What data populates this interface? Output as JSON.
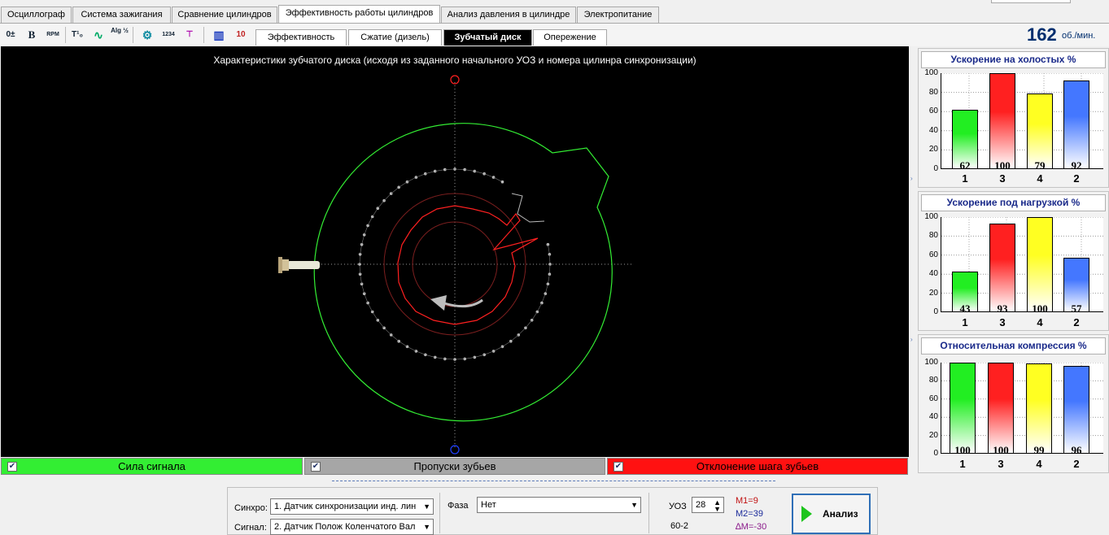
{
  "top_tabs": [
    {
      "label": "Осциллограф"
    },
    {
      "label": "Система зажигания"
    },
    {
      "label": "Сравнение цилиндров"
    },
    {
      "label": "Эффективность работы цилиндров",
      "active": true
    },
    {
      "label": "Анализ давления в цилиндре"
    },
    {
      "label": "Электропитание"
    }
  ],
  "toolbar": {
    "icons": [
      "zero-offset-icon",
      "bold-b-icon",
      "rpm-icon",
      "trigger-icon",
      "waveform-icon",
      "algorithm-icon",
      "tooth-wheel-icon",
      "cylinder-order-icon",
      "filter-icon",
      "bar-chart-icon",
      "scale-icon"
    ],
    "icon_glyphs": [
      "0±",
      "B",
      "RPM",
      "T¹₀",
      "∿",
      "Alg ½",
      "⚙",
      "1234",
      "⊤",
      "▥",
      "10"
    ],
    "sub_tabs": [
      {
        "label": "Эффективность"
      },
      {
        "label": "Сжатие (дизель)"
      },
      {
        "label": "Зубчатый диск",
        "active": true
      },
      {
        "label": "Опережение"
      }
    ]
  },
  "rpm": {
    "value": "162",
    "unit": "об./мин."
  },
  "canvas": {
    "title": "Характеристики зубчатого диска (исходя из заданного начального УОЗ и номера цилинра синхронизации)"
  },
  "legend": [
    {
      "label": "Сила сигнала",
      "checked": true,
      "color": "#33ee33"
    },
    {
      "label": "Пропуски зубьев",
      "checked": true,
      "color": "#a6a6a6"
    },
    {
      "label": "Отклонение шага зубьев",
      "checked": true,
      "color": "#ff1111"
    }
  ],
  "chart_data": [
    {
      "type": "bar",
      "title": "Ускорение на холостых %",
      "categories": [
        "1",
        "3",
        "4",
        "2"
      ],
      "values": [
        62,
        100,
        79,
        92
      ],
      "ylim": [
        0,
        100
      ],
      "yticks": [
        "0",
        "20",
        "40",
        "60",
        "80",
        "100"
      ],
      "colors": [
        "#22ee22",
        "#ff2020",
        "#ffff22",
        "#4477ff"
      ]
    },
    {
      "type": "bar",
      "title": "Ускорение под нагрузкой %",
      "categories": [
        "1",
        "3",
        "4",
        "2"
      ],
      "values": [
        43,
        93,
        100,
        57
      ],
      "ylim": [
        0,
        100
      ],
      "yticks": [
        "0",
        "20",
        "40",
        "60",
        "80",
        "100"
      ],
      "colors": [
        "#22ee22",
        "#ff2020",
        "#ffff22",
        "#4477ff"
      ]
    },
    {
      "type": "bar",
      "title": "Относительная компрессия %",
      "categories": [
        "1",
        "3",
        "4",
        "2"
      ],
      "values": [
        100,
        100,
        99,
        96
      ],
      "ylim": [
        0,
        100
      ],
      "yticks": [
        "0",
        "20",
        "40",
        "60",
        "80",
        "100"
      ],
      "colors": [
        "#22ee22",
        "#ff2020",
        "#ffff22",
        "#4477ff"
      ]
    }
  ],
  "bottom": {
    "sync_label": "Синхро:",
    "sync_value": "1.  Датчик синхронизации инд. лин",
    "signal_label": "Сигнал:",
    "signal_value": "2.  Датчик Полож Коленчатого Вал",
    "phase_label": "Фаза",
    "phase_value": "Нет",
    "uoz_label": "УОЗ",
    "uoz_value": "28",
    "disk_type": "60-2",
    "m1": "M1=9",
    "m2": "M2=39",
    "dm": "∆M=-30",
    "analyze_label": "Анализ"
  }
}
